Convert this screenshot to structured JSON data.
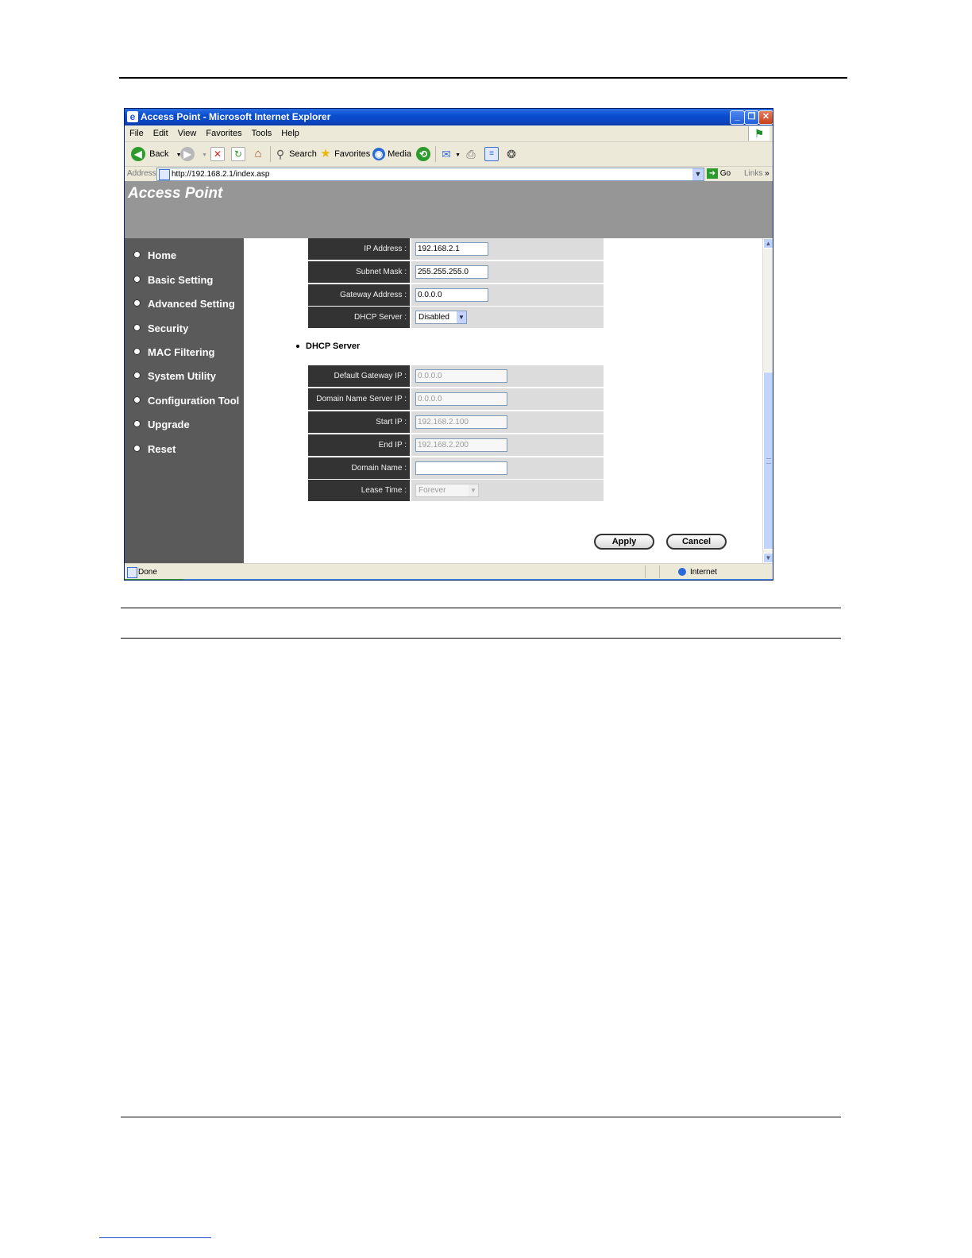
{
  "browser": {
    "title": "Access Point - Microsoft Internet Explorer",
    "menu": [
      "File",
      "Edit",
      "View",
      "Favorites",
      "Tools",
      "Help"
    ],
    "toolbar": {
      "back": "Back",
      "search": "Search",
      "favorites": "Favorites",
      "media": "Media"
    },
    "address_label": "Address",
    "url": "http://192.168.2.1/index.asp",
    "go": "Go",
    "links": "Links",
    "status": "Done",
    "zone": "Internet"
  },
  "page": {
    "brand": "Access Point",
    "nav": [
      "Home",
      "Basic Setting",
      "Advanced Setting",
      "Security",
      "MAC Filtering",
      "System Utility",
      "Configuration Tool",
      "Upgrade",
      "Reset"
    ],
    "lan_fields": [
      {
        "label": "IP Address :",
        "value": "192.168.2.1"
      },
      {
        "label": "Subnet Mask :",
        "value": "255.255.255.0"
      },
      {
        "label": "Gateway Address :",
        "value": "0.0.0.0"
      }
    ],
    "dhcp_select": {
      "label": "DHCP Server :",
      "value": "Disabled"
    },
    "dhcp_section_title": "DHCP Server",
    "dhcp_fields": [
      {
        "label": "Default Gateway IP :",
        "value": "0.0.0.0"
      },
      {
        "label": "Domain Name Server IP :",
        "value": "0.0.0.0"
      },
      {
        "label": "Start IP :",
        "value": "192.168.2.100"
      },
      {
        "label": "End IP :",
        "value": "192.168.2.200"
      },
      {
        "label": "Domain Name :",
        "value": ""
      }
    ],
    "lease_time": {
      "label": "Lease Time :",
      "value": "Forever"
    },
    "apply": "Apply",
    "cancel": "Cancel"
  }
}
